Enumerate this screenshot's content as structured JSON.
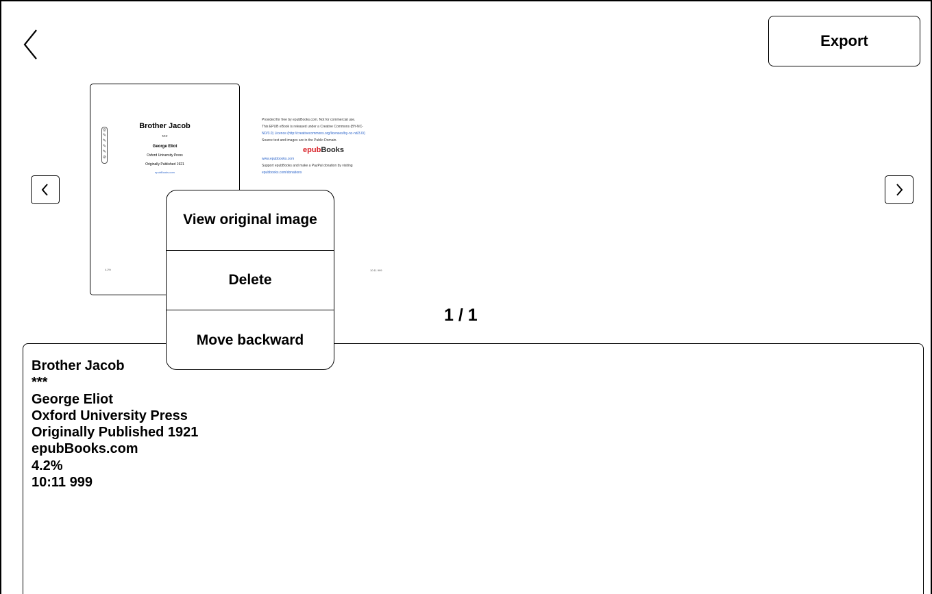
{
  "header": {
    "back_icon": "chevron-left-icon",
    "export_label": "Export"
  },
  "carousel": {
    "prev_icon": "chevron-left-icon",
    "next_icon": "chevron-right-icon",
    "page_indicator": "1 / 1",
    "thumbnail": {
      "title": "Brother Jacob",
      "separator": "***",
      "author": "George Eliot",
      "publisher": "Oxford University Press",
      "published": "Originally Published 1921",
      "site": "epubBooks.com",
      "footer": "4.2%"
    },
    "second_page": {
      "line1": "Provided for free by epubBooks.com. Not for commercial use.",
      "line2": "This EPUB eBook is released under a Creative Commons (BY-NC-",
      "line3": "ND/3.0) Licence (http://creativecommons.org/licenses/by-nc-nd/3.0/)",
      "line4": "Source text and images are in the Public Domain.",
      "logo_a": "epub",
      "logo_b": "Books",
      "link": "www.epubbooks.com",
      "line5": "Support epubBooks and make a PayPal donation by visiting",
      "line6": "epubbooks.com/donations",
      "footer": "10:11 999"
    }
  },
  "context_menu": {
    "items": [
      "View original image",
      "Delete",
      "Move backward"
    ]
  },
  "recognized_text": {
    "lines": [
      "Brother Jacob",
      "***",
      "George Eliot",
      "Oxford University Press",
      "Originally Published 1921",
      "epubBooks.com",
      "4.2%",
      "10:11 999"
    ]
  }
}
